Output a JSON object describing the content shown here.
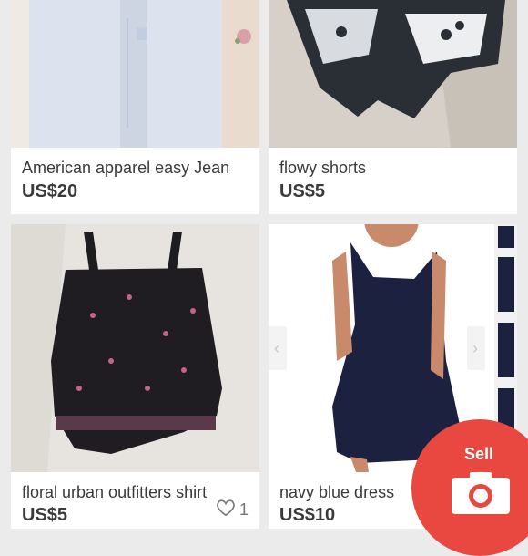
{
  "listings": [
    {
      "title": "American apparel easy Jean",
      "price": "US$20"
    },
    {
      "title": "flowy shorts",
      "price": "US$5"
    },
    {
      "title": "floral urban outfitters shirt",
      "price": "US$5",
      "likes": "1"
    },
    {
      "title": "navy blue dress",
      "price": "US$10"
    }
  ],
  "sell_button": {
    "label": "Sell"
  },
  "colors": {
    "accent": "#e8483f",
    "background": "#ebebeb",
    "card": "#ffffff",
    "text": "#3a3a3a"
  }
}
